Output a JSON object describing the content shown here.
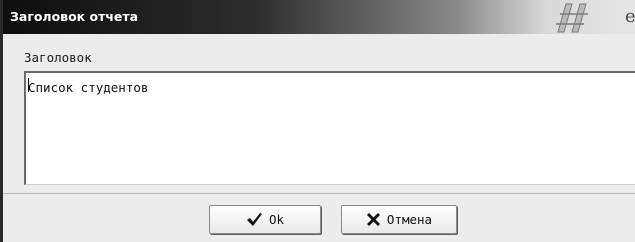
{
  "window": {
    "title": "Заголовок отчета",
    "title_suffix_glyph": "e"
  },
  "form": {
    "label": "Заголовок",
    "value": "Список студентов"
  },
  "buttons": {
    "ok_label": "Ok",
    "ok_icon": "checkmark-icon",
    "cancel_label": "Отмена",
    "cancel_icon": "x-icon"
  },
  "colors": {
    "titlebar_dark": "#0e0e0e",
    "titlebar_light": "#e6e6e6",
    "dialog_bg": "#ececec",
    "field_bg": "#ffffff"
  }
}
